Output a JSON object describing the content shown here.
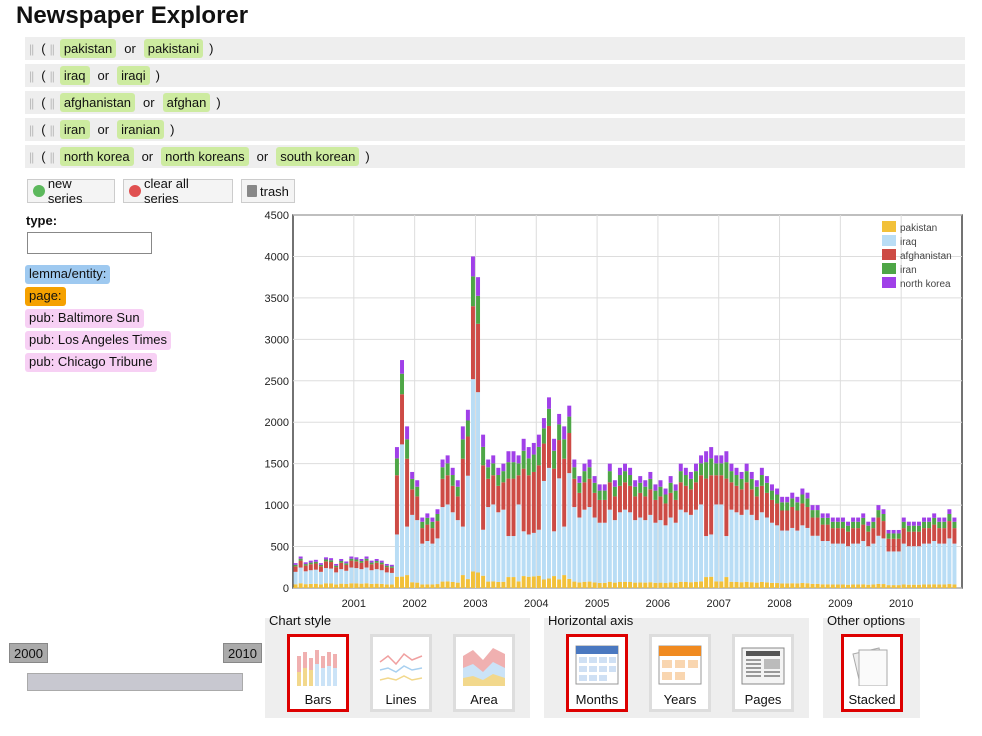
{
  "app_title": "Newspaper Explorer",
  "queries": [
    {
      "terms": [
        "pakistan",
        "pakistani"
      ]
    },
    {
      "terms": [
        "iraq",
        "iraqi"
      ]
    },
    {
      "terms": [
        "afghanistan",
        "afghan"
      ]
    },
    {
      "terms": [
        "iran",
        "iranian"
      ]
    },
    {
      "terms": [
        "north korea",
        "north koreans",
        "south korean"
      ]
    }
  ],
  "query_tokens": {
    "or": "or",
    "open": "(",
    "close": ")"
  },
  "toolbar": {
    "new_series": "new series",
    "clear_all": "clear all series",
    "trash": "trash"
  },
  "filters": {
    "type_label": "type:",
    "type_value": "",
    "tags": [
      {
        "label": "lemma/entity:",
        "color": "#9ec9f0"
      },
      {
        "label": "page:",
        "color": "#f5a100"
      },
      {
        "label": "pub: Baltimore Sun",
        "color": "#f7d0f4"
      },
      {
        "label": "pub: Los Angeles Times",
        "color": "#f7d0f4"
      },
      {
        "label": "pub: Chicago Tribune",
        "color": "#f7d0f4"
      }
    ]
  },
  "chart_data": {
    "type": "bar",
    "stacked": true,
    "ylim": [
      0,
      4500
    ],
    "yticks": [
      0,
      500,
      1000,
      1500,
      2000,
      2500,
      3000,
      3500,
      4000,
      4500
    ],
    "xlabels": [
      "2001",
      "2002",
      "2003",
      "2004",
      "2005",
      "2006",
      "2007",
      "2008",
      "2009",
      "2010"
    ],
    "legend_position": "top-right",
    "series": [
      {
        "name": "pakistan",
        "color": "#f2c13a"
      },
      {
        "name": "iraq",
        "color": "#b9ddf5"
      },
      {
        "name": "afghanistan",
        "color": "#cd4b45"
      },
      {
        "name": "iran",
        "color": "#4ea646"
      },
      {
        "name": "north korea",
        "color": "#a040e8"
      }
    ],
    "months_start": "2000-01",
    "totals": [
      300,
      380,
      310,
      330,
      340,
      300,
      370,
      360,
      290,
      350,
      320,
      380,
      370,
      350,
      380,
      330,
      350,
      330,
      290,
      280,
      1700,
      2750,
      1950,
      1400,
      1300,
      850,
      900,
      850,
      950,
      1550,
      1600,
      1450,
      1300,
      1950,
      2150,
      4000,
      3750,
      1850,
      1550,
      1600,
      1450,
      1500,
      1650,
      1650,
      1600,
      1800,
      1700,
      1750,
      1850,
      2050,
      2300,
      1800,
      2100,
      1950,
      2200,
      1550,
      1350,
      1500,
      1550,
      1350,
      1250,
      1250,
      1500,
      1300,
      1450,
      1500,
      1450,
      1300,
      1350,
      1300,
      1400,
      1250,
      1300,
      1200,
      1350,
      1250,
      1500,
      1450,
      1400,
      1500,
      1600,
      1650,
      1700,
      1600,
      1600,
      1650,
      1500,
      1450,
      1400,
      1500,
      1400,
      1300,
      1450,
      1350,
      1250,
      1200,
      1100,
      1100,
      1150,
      1100,
      1200,
      1150,
      1000,
      1000,
      900,
      900,
      850,
      850,
      850,
      800,
      850,
      850,
      900,
      800,
      850,
      1000,
      950,
      700,
      700,
      700,
      850,
      800,
      800,
      800,
      850,
      850,
      900,
      850,
      850,
      950,
      850
    ]
  },
  "slider": {
    "start": "2000",
    "end": "2010"
  },
  "chart_style": {
    "title": "Chart style",
    "options": [
      "Bars",
      "Lines",
      "Area"
    ],
    "selected": "Bars"
  },
  "horizontal_axis": {
    "title": "Horizontal axis",
    "options": [
      "Months",
      "Years",
      "Pages"
    ],
    "selected": "Months"
  },
  "other_options": {
    "title": "Other options",
    "options": [
      "Stacked"
    ],
    "selected": "Stacked"
  }
}
